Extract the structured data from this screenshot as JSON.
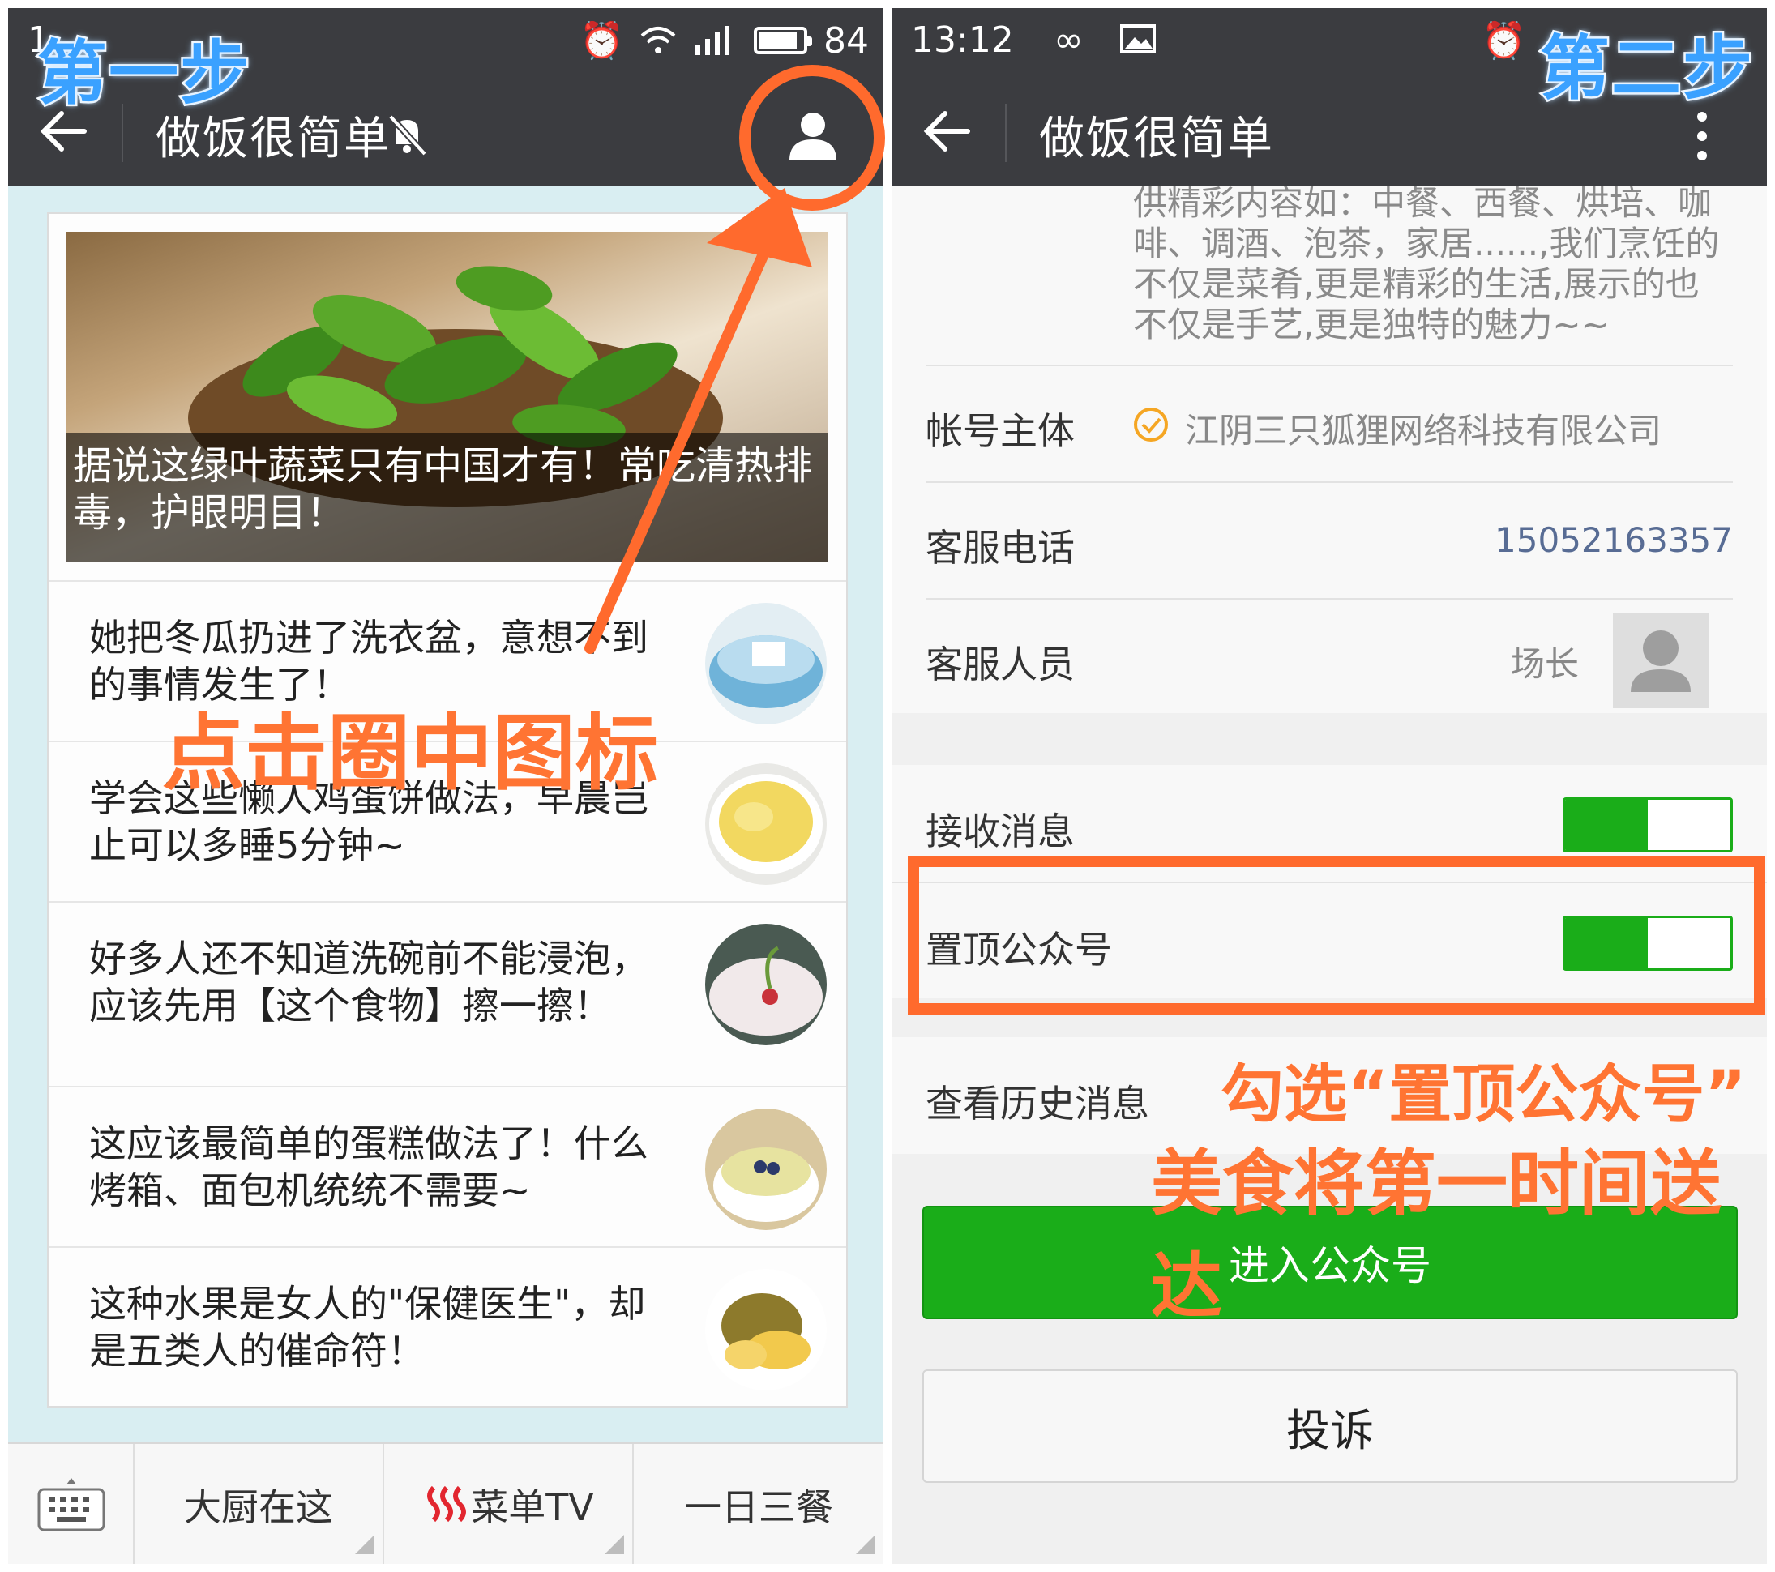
{
  "left": {
    "status": {
      "time": "1",
      "battery": "84"
    },
    "nav": {
      "title": "做饭很简单"
    },
    "hero_caption": "据说这绿叶蔬菜只有中国才有！常吃清热排毒，护眼明目！",
    "articles": [
      {
        "title": "她把冬瓜扔进了洗衣盆，意想不到的事情发生了！"
      },
      {
        "title": "学会这些懒人鸡蛋饼做法，早晨岂止可以多睡5分钟~"
      },
      {
        "title": "好多人还不知道洗碗前不能浸泡，应该先用【这个食物】擦一擦！"
      },
      {
        "title": "这应该最简单的蛋糕做法了！什么烤箱、面包机统统不需要~"
      },
      {
        "title": "这种水果是女人的\"保健医生\"，却是五类人的催命符！"
      }
    ],
    "menu": [
      {
        "label": "大厨在这"
      },
      {
        "label": "菜单TV"
      },
      {
        "label": "一日三餐"
      }
    ]
  },
  "right": {
    "status": {
      "time": "13:12"
    },
    "nav": {
      "title": "做饭很简单"
    },
    "intro": "供精彩内容如：中餐、西餐、烘培、咖啡、调酒、泡茶，家居......,我们烹饪的不仅是菜肴,更是精彩的生活,展示的也不仅是手艺,更是独特的魅力~~",
    "account_subject": {
      "label": "帐号主体",
      "value": "江阴三只狐狸网络科技有限公司"
    },
    "service_phone": {
      "label": "客服电话",
      "value": "15052163357"
    },
    "service_staff": {
      "label": "客服人员",
      "value": "场长"
    },
    "receive_messages": {
      "label": "接收消息",
      "on": 1
    },
    "pin_account": {
      "label": "置顶公众号",
      "on": 1
    },
    "history": {
      "label": "查看历史消息"
    },
    "enter_button": "进入公众号",
    "report_button": "投诉"
  },
  "annotations": {
    "step1": "第一步",
    "step2": "第二步",
    "tap_hint": "点击圈中图标",
    "pin_hint_line1": "勾选“置顶公众号”",
    "pin_hint_line2": "美食将第一时间送达"
  },
  "colors": {
    "accent_green": "#1aad19",
    "annotation_orange": "#ff6a2d",
    "step_blue": "#3aa1ff",
    "navbar_dark": "#3b3c40"
  }
}
